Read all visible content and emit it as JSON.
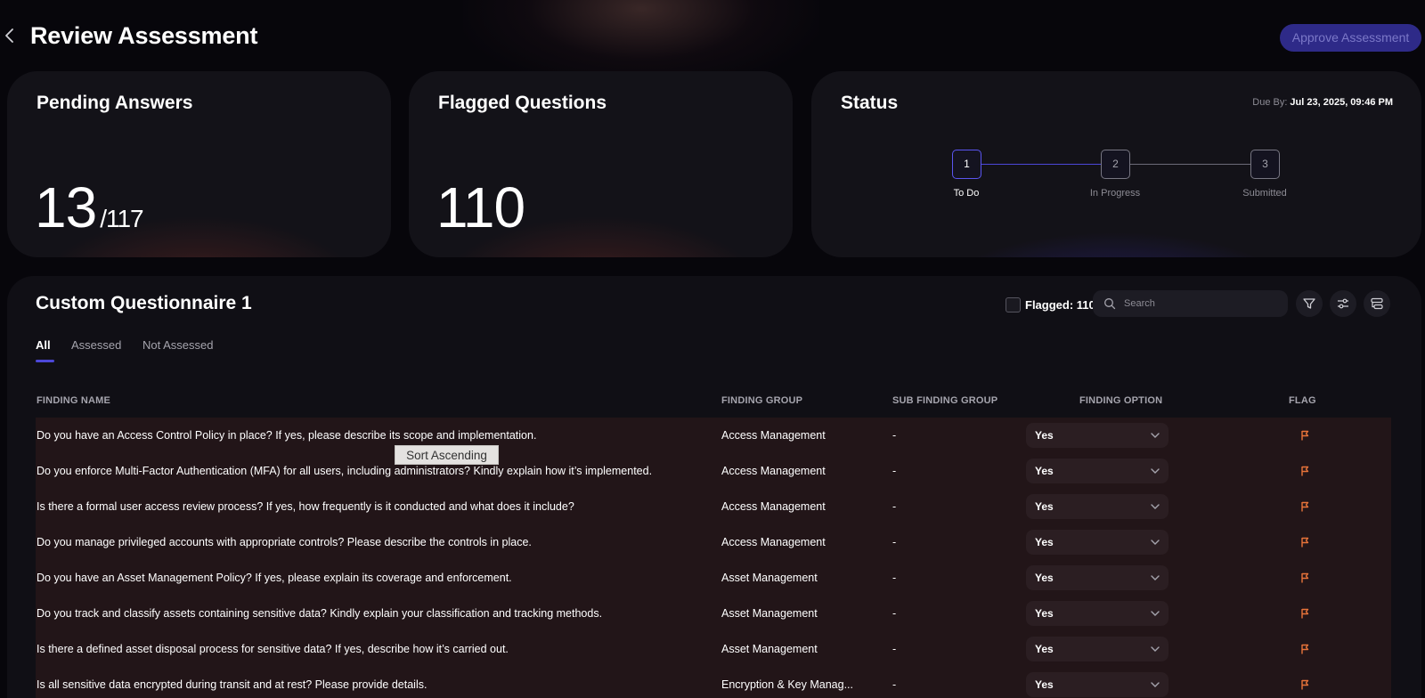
{
  "header": {
    "title": "Review Assessment",
    "approve_label": "Approve Assessment"
  },
  "cards": {
    "pending": {
      "title": "Pending Answers",
      "value": "13",
      "total": "/117"
    },
    "flagged": {
      "title": "Flagged Questions",
      "value": "110"
    },
    "status": {
      "title": "Status",
      "due_label": "Due By:",
      "due_value": "Jul 23, 2025, 09:46 PM",
      "steps": [
        {
          "number": "1",
          "label": "To Do"
        },
        {
          "number": "2",
          "label": "In Progress"
        },
        {
          "number": "3",
          "label": "Submitted"
        }
      ]
    }
  },
  "questionnaire": {
    "title": "Custom Questionnaire 1",
    "flagged_label": "Flagged: 110",
    "search_placeholder": "Search",
    "tabs": [
      "All",
      "Assessed",
      "Not Assessed"
    ],
    "columns": [
      "FINDING NAME",
      "FINDING GROUP",
      "SUB FINDING GROUP",
      "FINDING OPTION",
      "FLAG"
    ],
    "rows": [
      {
        "name": "Do you have an Access Control Policy in place? If yes, please describe its scope and implementation.",
        "group": "Access Management",
        "sub": "-",
        "option": "Yes"
      },
      {
        "name": "Do you enforce Multi-Factor Authentication (MFA) for all users, including administrators? Kindly explain how it’s implemented.",
        "group": "Access Management",
        "sub": "-",
        "option": "Yes"
      },
      {
        "name": "Is there a formal user access review process? If yes, how frequently is it conducted and what does it include?",
        "group": "Access Management",
        "sub": "-",
        "option": "Yes"
      },
      {
        "name": "Do you manage privileged accounts with appropriate controls? Please describe the controls in place.",
        "group": "Access Management",
        "sub": "-",
        "option": "Yes"
      },
      {
        "name": "Do you have an Asset Management Policy? If yes, please explain its coverage and enforcement.",
        "group": "Asset Management",
        "sub": "-",
        "option": "Yes"
      },
      {
        "name": "Do you track and classify assets containing sensitive data? Kindly explain your classification and tracking methods.",
        "group": "Asset Management",
        "sub": "-",
        "option": "Yes"
      },
      {
        "name": "Is there a defined asset disposal process for sensitive data? If yes, describe how it’s carried out.",
        "group": "Asset Management",
        "sub": "-",
        "option": "Yes"
      },
      {
        "name": "Is all sensitive data encrypted during transit and at rest? Please provide details.",
        "group": "Encryption & Key Manag...",
        "sub": "-",
        "option": "Yes"
      }
    ]
  },
  "tooltip": "Sort Ascending",
  "colors": {
    "accent": "#4c47d8",
    "flag": "#e8743a",
    "row_bg": "#221518"
  }
}
